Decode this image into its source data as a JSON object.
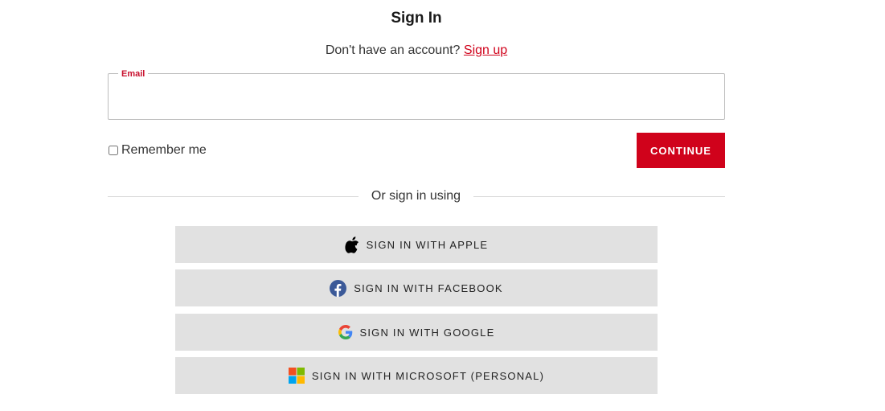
{
  "header": {
    "title": "Sign In",
    "signup_prompt": "Don't have an account?",
    "signup_link": "Sign up"
  },
  "email": {
    "label": "Email",
    "value": "",
    "placeholder": ""
  },
  "remember": {
    "label": "Remember me",
    "checked": false
  },
  "continue_button": {
    "label": "CONTINUE"
  },
  "divider": {
    "text": "Or sign in using"
  },
  "social_buttons": [
    {
      "icon": "apple-icon",
      "label": "SIGN IN WITH APPLE"
    },
    {
      "icon": "facebook-icon",
      "label": "SIGN IN WITH FACEBOOK"
    },
    {
      "icon": "google-icon",
      "label": "SIGN IN WITH GOOGLE"
    },
    {
      "icon": "microsoft-icon",
      "label": "SIGN IN WITH MICROSOFT (PERSONAL)"
    }
  ],
  "colors": {
    "accent": "#d0021b",
    "social_button_bg": "#e1e1e1"
  }
}
